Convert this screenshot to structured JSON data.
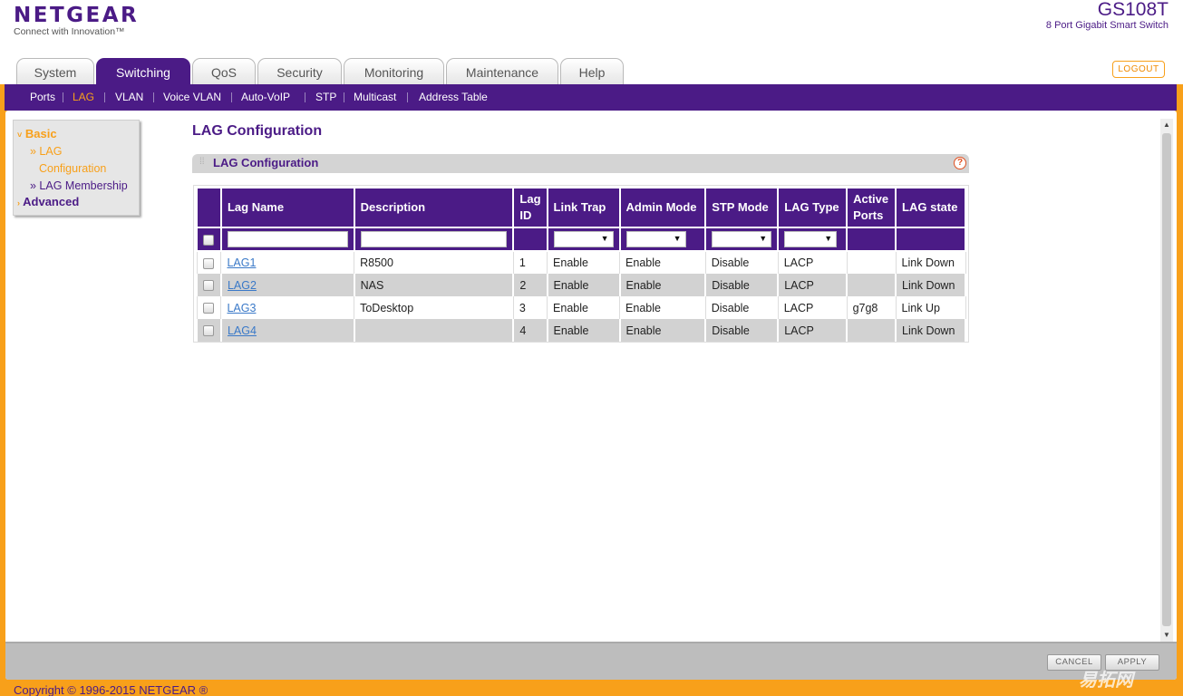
{
  "brand": {
    "logo": "NETGEAR",
    "tagline": "Connect with Innovation™",
    "model": "GS108T",
    "model_desc": "8 Port Gigabit Smart Switch"
  },
  "tabs": [
    "System",
    "Switching",
    "QoS",
    "Security",
    "Monitoring",
    "Maintenance",
    "Help"
  ],
  "active_tab": "Switching",
  "logout": "LOGOUT",
  "subnav": [
    "Ports",
    "LAG",
    "VLAN",
    "Voice VLAN",
    "Auto-VoIP",
    "STP",
    "Multicast",
    "Address Table"
  ],
  "active_subnav": "LAG",
  "sidebar": {
    "basic": "Basic",
    "item1_line1": "» LAG",
    "item1_line2": "Configuration",
    "item2": "» LAG Membership",
    "advanced": "Advanced"
  },
  "page_title": "LAG Configuration",
  "section_title": "LAG Configuration",
  "help_glyph": "?",
  "table": {
    "headers": [
      "Lag Name",
      "Description",
      "Lag ID",
      "Link Trap",
      "Admin Mode",
      "STP Mode",
      "LAG Type",
      "Active Ports",
      "LAG state"
    ],
    "rows": [
      {
        "name": "LAG1",
        "description": "R8500",
        "id": "1",
        "link_trap": "Enable",
        "admin_mode": "Enable",
        "stp_mode": "Disable",
        "type": "LACP",
        "active_ports": "",
        "state": "Link Down"
      },
      {
        "name": "LAG2",
        "description": "NAS",
        "id": "2",
        "link_trap": "Enable",
        "admin_mode": "Enable",
        "stp_mode": "Disable",
        "type": "LACP",
        "active_ports": "",
        "state": "Link Down"
      },
      {
        "name": "LAG3",
        "description": "ToDesktop",
        "id": "3",
        "link_trap": "Enable",
        "admin_mode": "Enable",
        "stp_mode": "Disable",
        "type": "LACP",
        "active_ports": "g7g8",
        "state": "Link Up"
      },
      {
        "name": "LAG4",
        "description": "",
        "id": "4",
        "link_trap": "Enable",
        "admin_mode": "Enable",
        "stp_mode": "Disable",
        "type": "LACP",
        "active_ports": "",
        "state": "Link Down"
      }
    ]
  },
  "buttons": {
    "cancel": "CANCEL",
    "apply": "APPLY"
  },
  "copyright": "Copyright © 1996-2015 NETGEAR ®",
  "watermark": "易拓网",
  "colors": {
    "brand_purple": "#4b1b86",
    "accent_orange": "#f8a01a",
    "link_blue": "#3a79c8"
  }
}
